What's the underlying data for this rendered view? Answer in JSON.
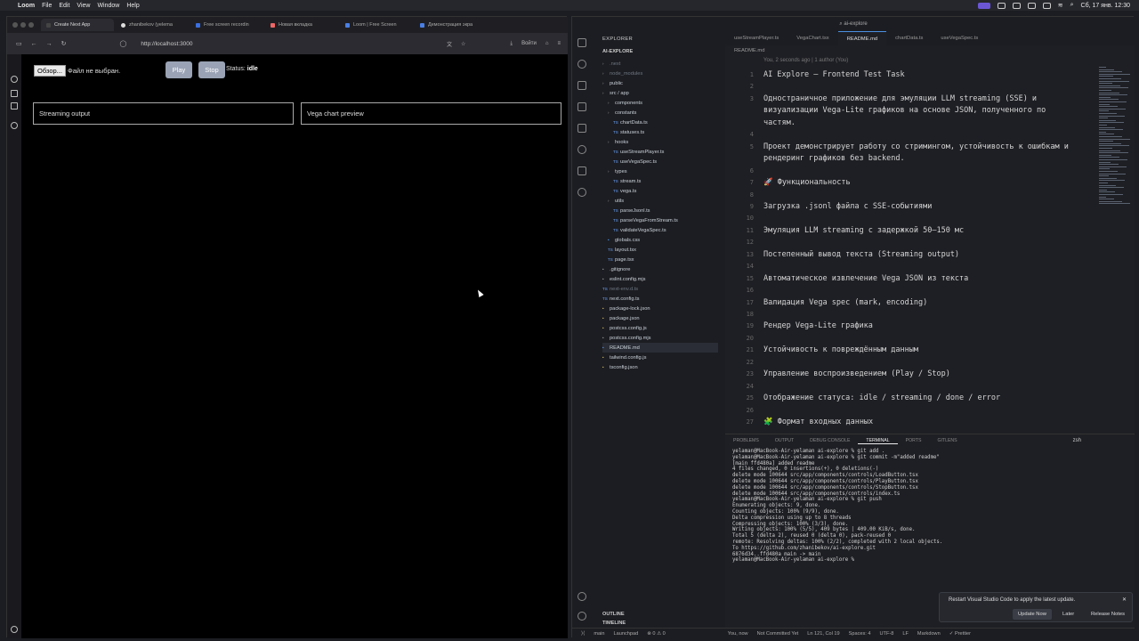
{
  "menubar": {
    "app": "Loom",
    "items": [
      "File",
      "Edit",
      "View",
      "Window",
      "Help"
    ],
    "clock": "Сб, 17 янв. 12:30"
  },
  "browser": {
    "tabs": [
      "Create Next App",
      "zhanibekov (yelema",
      "Free screen recordin",
      "Новая вкладка",
      "Loom | Free Screen",
      "Демонстрация экра"
    ],
    "url": "http://localhost:3000",
    "login": "Войти"
  },
  "app": {
    "file_button": "Обзор...",
    "file_label": "Файл не выбран.",
    "play": "Play",
    "stop": "Stop",
    "status_label": "Status:",
    "status_value": "idle",
    "panel_left": "Streaming output",
    "panel_right": "Vega chart preview"
  },
  "vscode": {
    "title": "ai-explore",
    "explorer_header": "EXPLORER",
    "root": "AI-EXPLORE",
    "tree": [
      {
        "name": ".next",
        "indent": 0,
        "type": "folder"
      },
      {
        "name": "node_modules",
        "indent": 0,
        "type": "folder"
      },
      {
        "name": "public",
        "indent": 0,
        "type": "folder"
      },
      {
        "name": "src / app",
        "indent": 0,
        "type": "folder"
      },
      {
        "name": "components",
        "indent": 1,
        "type": "folder"
      },
      {
        "name": "constants",
        "indent": 1,
        "type": "folder"
      },
      {
        "name": "chartData.ts",
        "indent": 2,
        "type": "ts"
      },
      {
        "name": "statuses.ts",
        "indent": 2,
        "type": "ts"
      },
      {
        "name": "hooks",
        "indent": 1,
        "type": "folder"
      },
      {
        "name": "useStreamPlayer.ts",
        "indent": 2,
        "type": "ts"
      },
      {
        "name": "useVegaSpec.ts",
        "indent": 2,
        "type": "ts"
      },
      {
        "name": "types",
        "indent": 1,
        "type": "folder"
      },
      {
        "name": "stream.ts",
        "indent": 2,
        "type": "ts"
      },
      {
        "name": "vega.ts",
        "indent": 2,
        "type": "ts"
      },
      {
        "name": "utils",
        "indent": 1,
        "type": "folder"
      },
      {
        "name": "parseJsonl.ts",
        "indent": 2,
        "type": "ts"
      },
      {
        "name": "parseVegaFromStream.ts",
        "indent": 2,
        "type": "ts"
      },
      {
        "name": "validateVegaSpec.ts",
        "indent": 2,
        "type": "ts"
      },
      {
        "name": "globals.css",
        "indent": 1,
        "type": "css"
      },
      {
        "name": "layout.tsx",
        "indent": 1,
        "type": "tsx"
      },
      {
        "name": "page.tsx",
        "indent": 1,
        "type": "tsx"
      },
      {
        "name": ".gitignore",
        "indent": 0,
        "type": "file"
      },
      {
        "name": "eslint.config.mjs",
        "indent": 0,
        "type": "file"
      },
      {
        "name": "next-env.d.ts",
        "indent": 0,
        "type": "ts"
      },
      {
        "name": "next.config.ts",
        "indent": 0,
        "type": "ts"
      },
      {
        "name": "package-lock.json",
        "indent": 0,
        "type": "json"
      },
      {
        "name": "package.json",
        "indent": 0,
        "type": "json"
      },
      {
        "name": "postcss.config.js",
        "indent": 0,
        "type": "js"
      },
      {
        "name": "postcss.config.mjs",
        "indent": 0,
        "type": "file"
      },
      {
        "name": "README.md",
        "indent": 0,
        "type": "md"
      },
      {
        "name": "tailwind.config.js",
        "indent": 0,
        "type": "js"
      },
      {
        "name": "tsconfig.json",
        "indent": 0,
        "type": "json"
      }
    ],
    "outline": "OUTLINE",
    "timeline": "TIMELINE",
    "editor_tabs": [
      "useStreamPlayer.ts",
      "VegaChart.tsx",
      "README.md",
      "chartData.ts",
      "useVegaSpec.ts"
    ],
    "active_tab": "README.md",
    "breadcrumb": "README.md",
    "blame": "You, 2 seconds ago | 1 author (You)",
    "code_lines": [
      {
        "n": "1",
        "t": "AI Explore — Frontend Test Task"
      },
      {
        "n": "2",
        "t": ""
      },
      {
        "n": "3",
        "t": "Одностраничное приложение для эмуляции LLM streaming (SSE) и"
      },
      {
        "n": "",
        "t": "визуализации Vega-Lite графиков на основе JSON, полученного по"
      },
      {
        "n": "",
        "t": "частям."
      },
      {
        "n": "4",
        "t": ""
      },
      {
        "n": "5",
        "t": "Проект демонстрирует работу со стримингом, устойчивость к ошибкам и"
      },
      {
        "n": "",
        "t": "рендеринг графиков без backend."
      },
      {
        "n": "6",
        "t": ""
      },
      {
        "n": "7",
        "t": "🚀 Функциональность"
      },
      {
        "n": "8",
        "t": ""
      },
      {
        "n": "9",
        "t": "Загрузка .jsonl файла с SSE-событиями"
      },
      {
        "n": "10",
        "t": ""
      },
      {
        "n": "11",
        "t": "Эмуляция LLM streaming с задержкой 50–150 мс"
      },
      {
        "n": "12",
        "t": ""
      },
      {
        "n": "13",
        "t": "Постепенный вывод текста (Streaming output)"
      },
      {
        "n": "14",
        "t": ""
      },
      {
        "n": "15",
        "t": "Автоматическое извлечение Vega JSON из текста"
      },
      {
        "n": "16",
        "t": ""
      },
      {
        "n": "17",
        "t": "Валидация Vega spec (mark, encoding)"
      },
      {
        "n": "18",
        "t": ""
      },
      {
        "n": "19",
        "t": "Рендер Vega-Lite графика"
      },
      {
        "n": "20",
        "t": ""
      },
      {
        "n": "21",
        "t": "Устойчивость к повреждённым данным"
      },
      {
        "n": "22",
        "t": ""
      },
      {
        "n": "23",
        "t": "Управление воспроизведением (Play / Stop)"
      },
      {
        "n": "24",
        "t": ""
      },
      {
        "n": "25",
        "t": "Отображение статуса: idle / streaming / done / error"
      },
      {
        "n": "26",
        "t": ""
      },
      {
        "n": "27",
        "t": "🧩 Формат входных данных"
      }
    ],
    "panel_tabs": [
      "PROBLEMS",
      "OUTPUT",
      "DEBUG CONSOLE",
      "TERMINAL",
      "PORTS",
      "GITLENS"
    ],
    "active_panel": "TERMINAL",
    "shell": "zsh",
    "terminal": [
      "yelaman@MacBook-Air-yelaman ai-explore % git add .",
      "yelaman@MacBook-Air-yelaman ai-explore % git commit -m\"added readme\"",
      "[main ffd480a] added readme",
      " 4 files changed, 0 insertions(+), 0 deletions(-)",
      " delete mode 100644 src/app/components/controls/LoadButton.tsx",
      " delete mode 100644 src/app/components/controls/PlayButton.tsx",
      " delete mode 100644 src/app/components/controls/StopButton.tsx",
      " delete mode 100644 src/app/components/controls/index.ts",
      "yelaman@MacBook-Air-yelaman ai-explore % git push",
      "Enumerating objects: 9, done.",
      "Counting objects: 100% (9/9), done.",
      "Delta compression using up to 8 threads",
      "Compressing objects: 100% (3/3), done.",
      "Writing objects: 100% (5/5), 409 bytes | 409.00 KiB/s, done.",
      "Total 5 (delta 2), reused 0 (delta 0), pack-reused 0",
      "remote: Resolving deltas: 100% (2/2), completed with 2 local objects.",
      "To https://github.com/zhanibekov/ai-explore.git",
      "   6876d34..ffd480a  main -> main",
      "yelaman@MacBook-Air-yelaman ai-explore % "
    ],
    "notification": {
      "text": "Restart Visual Studio Code to apply the latest update.",
      "update": "Update Now",
      "later": "Later",
      "notes": "Release Notes"
    },
    "status": {
      "branch": "main",
      "launchpad": "Launchpad",
      "problems": "⊗ 0 ⚠ 0",
      "author": "You, now",
      "commit": "Not Committed Yet",
      "position": "Ln 121, Col 19",
      "spaces": "Spaces: 4",
      "encoding": "UTF-8",
      "eol": "LF",
      "lang": "Markdown",
      "prettier": "✓ Prettier"
    }
  }
}
